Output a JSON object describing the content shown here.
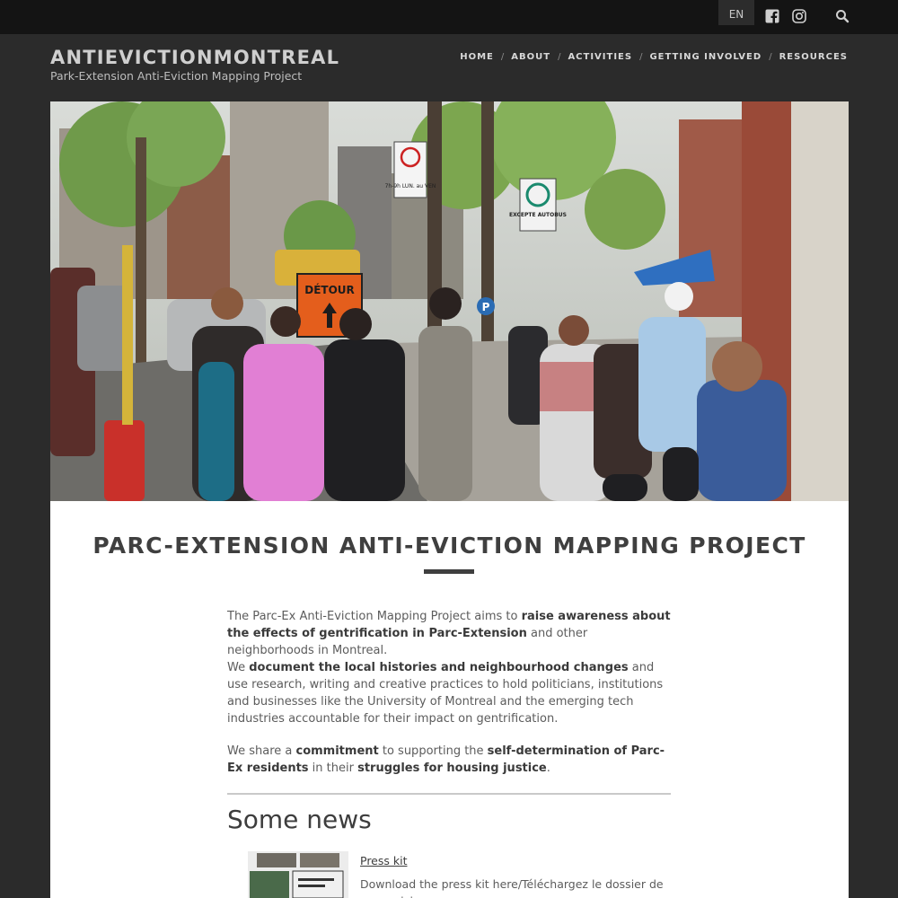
{
  "topbar": {
    "language": "EN",
    "icons": [
      "facebook-icon",
      "instagram-icon",
      "search-icon"
    ]
  },
  "header": {
    "site_title": "ANTIEVICTIONMONTREAL",
    "tagline": "Park-Extension Anti-Eviction Mapping Project",
    "nav": [
      {
        "label": "HOME"
      },
      {
        "label": "ABOUT"
      },
      {
        "label": "ACTIVITIES"
      },
      {
        "label": "GETTING INVOLVED"
      },
      {
        "label": "RESOURCES"
      }
    ]
  },
  "hero": {
    "signs": {
      "detour": "DÉTOUR",
      "bus": "EXCEPTE AUTOBUS",
      "parking": "7h-9h LUN. au VEN",
      "transit": "P"
    }
  },
  "main": {
    "title": "PARC-EXTENSION ANTI-EVICTION MAPPING PROJECT",
    "p1": {
      "a": "The Parc-Ex Anti-Eviction Mapping Project aims to ",
      "b": "raise awareness about the effects of gentrification in Parc-Extension",
      "c": " and other neighborhoods in Montreal."
    },
    "p2": {
      "a": "We ",
      "b": "document the local histories and neighbourhood changes",
      "c": " and use research, writing and creative practices to hold politicians, institutions and businesses like the University of Montreal and the emerging tech industries accountable for their impact on gentrification."
    },
    "p3": {
      "a": "We share a ",
      "b": "commitment",
      "c": " to supporting the ",
      "d": "self-determination of Parc-Ex residents",
      "e": " in their ",
      "f": "struggles for housing justice",
      "g": "."
    },
    "news": {
      "title": "Some news",
      "item": {
        "link": "Press kit",
        "description": "Download the press kit here/Téléchargez le dossier de presse ici"
      }
    }
  },
  "colors": {
    "page_bg": "#2b2b2b",
    "topbar_bg": "#141414",
    "content_bg": "#ffffff",
    "heading": "#3f3f3f",
    "body_text": "#5c5c5c"
  }
}
